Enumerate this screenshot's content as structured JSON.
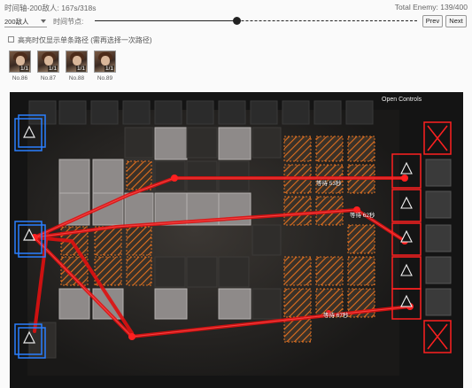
{
  "header": {
    "timeline": "时间轴-200敌人: 167s/318s",
    "total_enemy": "Total Enemy: 139/400"
  },
  "controls": {
    "select_value": "200敌人",
    "node_label": "时间节点:",
    "progress": 0.44,
    "prev_label": "Prev",
    "next_label": "Next"
  },
  "options": {
    "highlight_label": "高亮时仅显示单条路径 (需再选择一次路径)",
    "checked": false
  },
  "enemies": [
    {
      "count": "1/1",
      "no": "No.86"
    },
    {
      "count": "1/1",
      "no": "No.87"
    },
    {
      "count": "1/1",
      "no": "No.88"
    },
    {
      "count": "1/1",
      "no": "No.89"
    }
  ],
  "map": {
    "open_controls": "Open Controls",
    "wait_labels": [
      "等待 53秒",
      "等待 62秒",
      "等待 67秒"
    ]
  },
  "colors": {
    "route": "#e01010",
    "spawn": "#2a7fff",
    "danger": "#ff2020",
    "highlight_tile": "#e07020"
  }
}
